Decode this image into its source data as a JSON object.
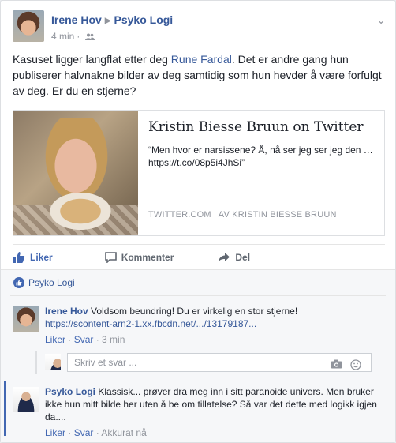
{
  "post": {
    "author": "Irene Hov",
    "target_page": "Psyko Logi",
    "time": "4 min",
    "text_before": "Kasuset ligger langflat etter deg ",
    "tagged": "Rune Fardal",
    "text_after": ". Det er andre gang hun publiserer halvnakne bilder av deg samtidig som hun hevder å være forfulgt av deg. Er du en stjerne?"
  },
  "preview": {
    "title": "Kristin Biesse Bruun on Twitter",
    "description": "“Men hvor er narsissene? Å, nå ser jeg ser jeg den … https://t.co/08p5i4JhSi”",
    "source": "TWITTER.COM | AV KRISTIN BIESSE BRUUN"
  },
  "actions": {
    "like": "Liker",
    "comment": "Kommenter",
    "share": "Del"
  },
  "likes_summary": "Psyko Logi",
  "comments": [
    {
      "author": "Irene Hov",
      "text": " Voldsom beundring! Du er virkelig en stor stjerne!",
      "link": "https://scontent-arn2-1.xx.fbcdn.net/.../13179187...",
      "like": "Liker",
      "reply": "Svar",
      "time": "3 min"
    },
    {
      "author": "Psyko Logi",
      "text": " Klassisk... prøver dra meg inn i sitt paranoide univers. Men bruker ikke hun mitt bilde her uten å be om tillatelse? Så var det dette med logikk igjen da....",
      "like": "Liker",
      "reply": "Svar",
      "time": "Akkurat nå"
    }
  ],
  "reply_placeholder": "Skriv et svar ...",
  "colors": {
    "link": "#365899",
    "accent": "#4267b2",
    "muted": "#90949c"
  },
  "icons": [
    "friends-icon",
    "chevron-down-icon",
    "like-icon",
    "comment-icon",
    "share-icon",
    "camera-icon",
    "emoji-icon"
  ]
}
